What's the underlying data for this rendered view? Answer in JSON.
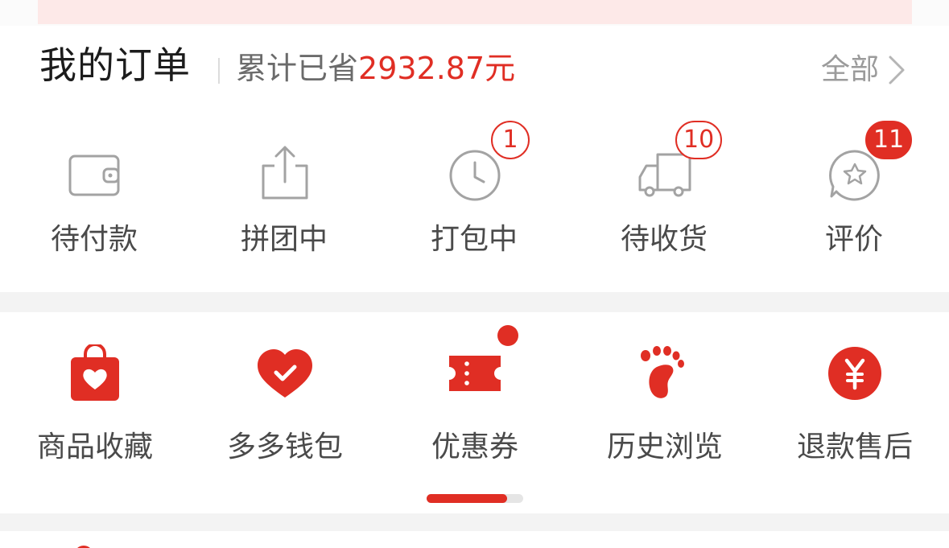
{
  "orders": {
    "title": "我的订单",
    "savings_label": "累计已省",
    "savings_amount": "2932.87元",
    "view_all": "全部",
    "items": [
      {
        "label": "待付款",
        "icon": "wallet-icon",
        "badge": null
      },
      {
        "label": "拼团中",
        "icon": "share-box-icon",
        "badge": null
      },
      {
        "label": "打包中",
        "icon": "clock-icon",
        "badge": "1"
      },
      {
        "label": "待收货",
        "icon": "truck-icon",
        "badge": "10"
      },
      {
        "label": "评价",
        "icon": "star-bubble-icon",
        "badge": "11"
      }
    ]
  },
  "tools": {
    "items": [
      {
        "label": "商品收藏",
        "icon": "heart-bag-icon"
      },
      {
        "label": "多多钱包",
        "icon": "heart-check-icon"
      },
      {
        "label": "优惠券",
        "icon": "ticket-icon",
        "has_dot": true
      },
      {
        "label": "历史浏览",
        "icon": "footprint-icon"
      },
      {
        "label": "退款售后",
        "icon": "yen-circle-icon"
      }
    ],
    "page_indicator_progress": 0.83
  },
  "colors": {
    "accent": "#e02e24",
    "text_primary": "#1c1c1c",
    "text_secondary": "#4a4a4a",
    "muted": "#9b9b9b"
  }
}
